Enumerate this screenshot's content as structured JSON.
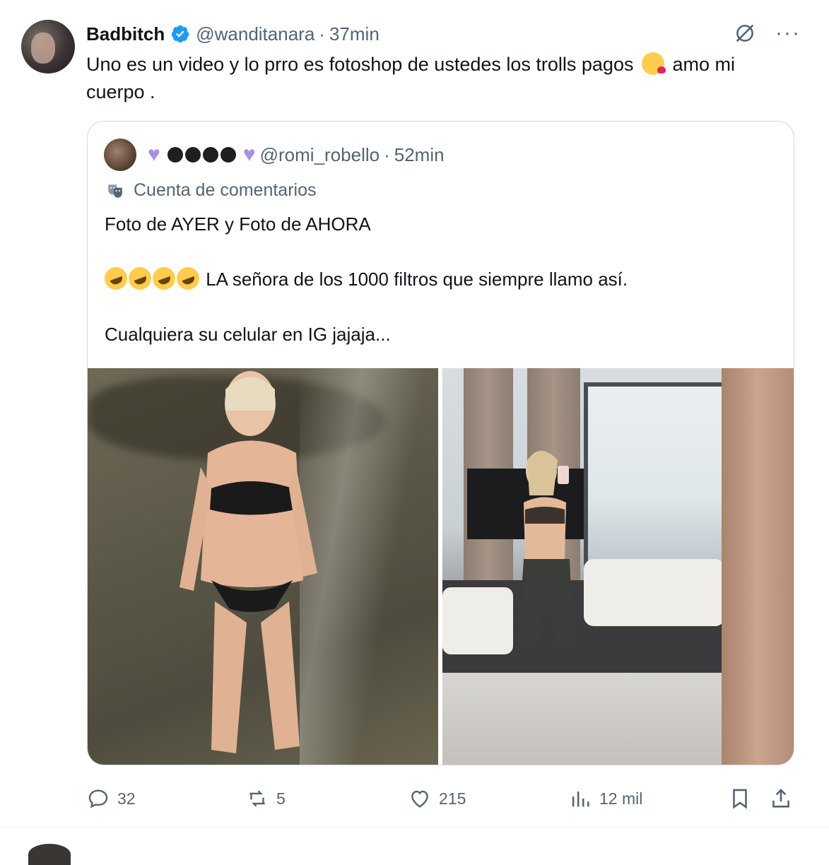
{
  "tweet": {
    "display_name": "Badbitch",
    "handle": "@wanditanara",
    "separator": "·",
    "time": "37min",
    "text_part1": "Uno es un video y lo prro es fotoshop de ustedes los trolls pagos ",
    "text_part2": " amo mi cuerpo ."
  },
  "quote": {
    "handle": "@romi_robello",
    "separator": "·",
    "time": "52min",
    "label": "Cuenta de comentarios",
    "line1": "Foto de AYER  y Foto de AHORA",
    "line2": " LA señora de los 1000 filtros que siempre llamo así.",
    "line3": "Cualquiera su celular en IG jajaja..."
  },
  "actions": {
    "replies": "32",
    "reposts": "5",
    "likes": "215",
    "views": "12 mil"
  },
  "colors": {
    "verified": "#1d9bf0",
    "secondary_text": "#536471",
    "border": "#cfd9de",
    "heart_purple": "#ab8fe0"
  },
  "icons": [
    "verified-badge-icon",
    "grok-icon",
    "more-icon",
    "theater-mask-icon",
    "reply-icon",
    "repost-icon",
    "like-icon",
    "views-icon",
    "bookmark-icon",
    "share-icon"
  ]
}
